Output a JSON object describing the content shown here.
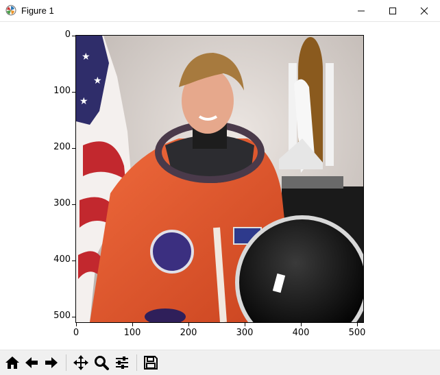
{
  "window": {
    "title": "Figure 1",
    "icon": "matplotlib-icon",
    "controls": [
      "minimize-icon",
      "maximize-icon",
      "close-icon"
    ]
  },
  "figure": {
    "image_description_icon": "astronaut-photo",
    "y_ticks": [
      "0",
      "100",
      "200",
      "300",
      "400",
      "500"
    ],
    "x_ticks": [
      "0",
      "100",
      "200",
      "300",
      "400",
      "500"
    ]
  },
  "toolbar": {
    "buttons": [
      "home-icon",
      "back-icon",
      "forward-icon",
      "pan-icon",
      "zoom-icon",
      "configure-subplots-icon",
      "save-icon"
    ]
  },
  "colors": {
    "suit": "#e0562d",
    "background_wall": "#d9d2cc",
    "toolbar_bg": "#f0f0f0"
  }
}
